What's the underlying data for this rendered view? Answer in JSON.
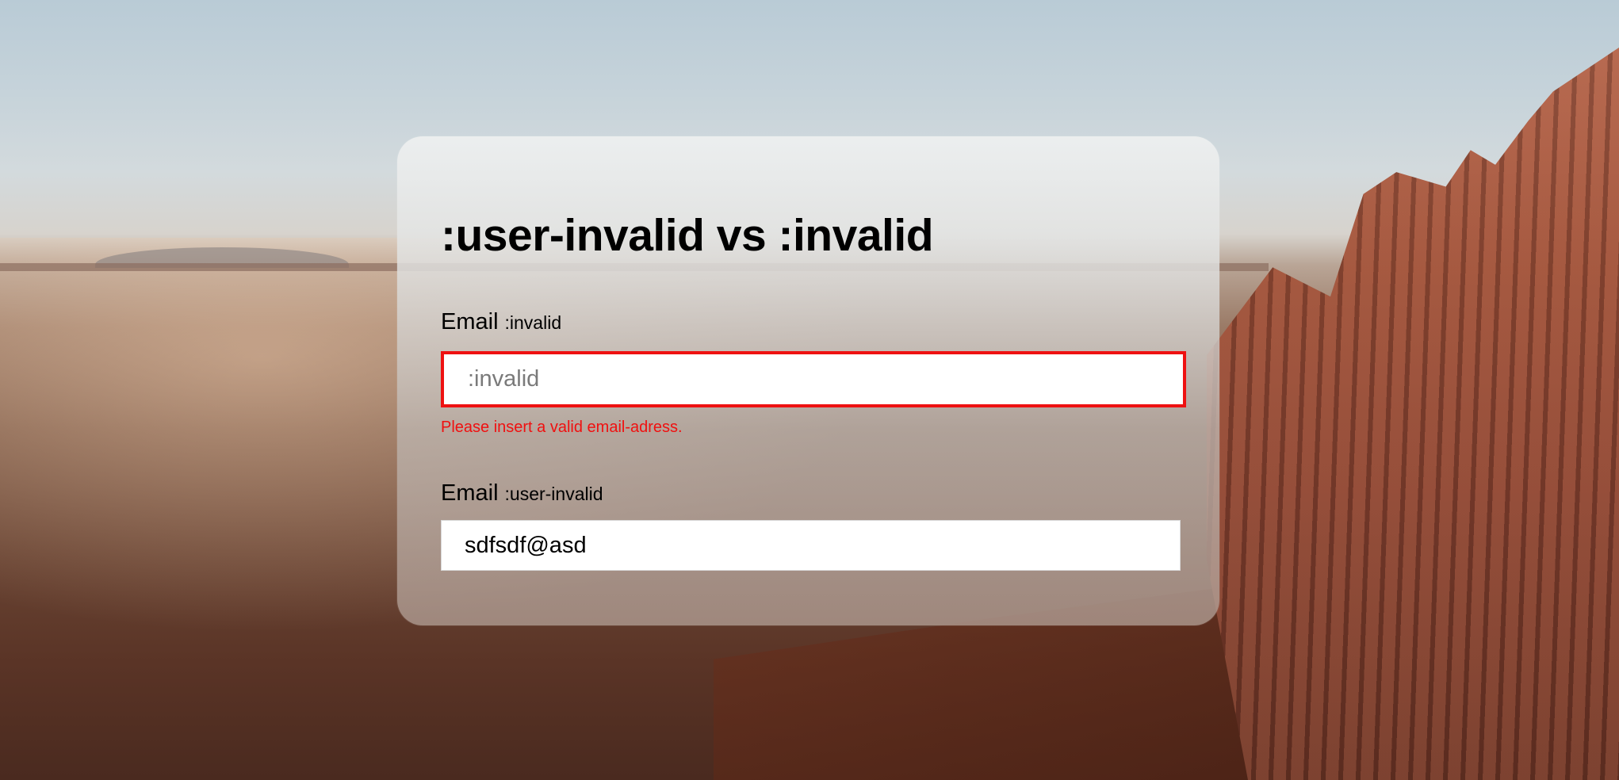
{
  "page": {
    "title": ":user-invalid vs :invalid"
  },
  "fields": [
    {
      "label": "Email",
      "pseudo": ":invalid",
      "placeholder": ":invalid",
      "value": "",
      "error": "Please insert a valid email-adress."
    },
    {
      "label": "Email",
      "pseudo": ":user-invalid",
      "placeholder": "",
      "value": "sdfsdf@asd"
    }
  ],
  "colors": {
    "error": "#ee1111",
    "input_background": "#ffffff",
    "text": "#000000"
  }
}
